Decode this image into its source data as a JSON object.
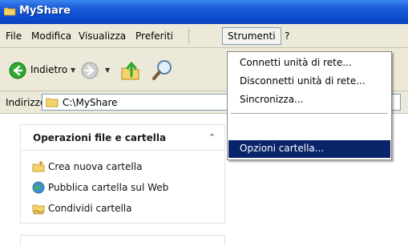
{
  "window": {
    "title": "MyShare"
  },
  "menubar": {
    "items": [
      {
        "label": "File"
      },
      {
        "label": "Modifica"
      },
      {
        "label": "Visualizza"
      },
      {
        "label": "Preferiti"
      },
      {
        "label": "Strumenti"
      },
      {
        "label": "?"
      }
    ]
  },
  "toolbar": {
    "back_label": "Indietro"
  },
  "address": {
    "label": "Indirizzo",
    "value": "C:\\MyShare"
  },
  "tools_menu": {
    "items": [
      {
        "label": "Connetti unità di rete..."
      },
      {
        "label": "Disconnetti unità di rete..."
      },
      {
        "label": "Sincronizza..."
      },
      {
        "label": "Opzioni cartella..."
      }
    ]
  },
  "task_panel": {
    "title": "Operazioni file e cartella",
    "links": [
      {
        "label": "Crea nuova cartella",
        "icon": "new-folder-icon"
      },
      {
        "label": "Pubblica cartella sul Web",
        "icon": "publish-web-icon"
      },
      {
        "label": "Condividi cartella",
        "icon": "share-folder-icon"
      }
    ]
  },
  "colors": {
    "titlebar": "#0b4ccf",
    "menu_highlight": "#0a246a",
    "chrome": "#ece9d8"
  }
}
